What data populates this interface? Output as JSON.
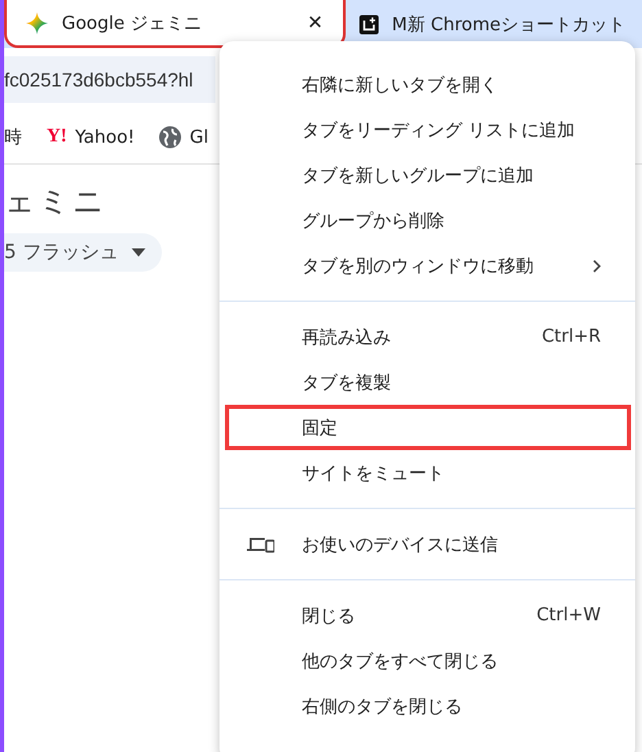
{
  "tabs": [
    {
      "title": "Google ジェミニ",
      "close": "✕",
      "selected": true,
      "highlighted": true
    },
    {
      "title": "M新 Chromeショートカット",
      "selected": false,
      "highlighted": false
    }
  ],
  "address_bar": {
    "url": "fc025173d6bcb554?hl"
  },
  "bookmarks": [
    {
      "kind": "plain",
      "label": "時"
    },
    {
      "kind": "yahoo",
      "logo": "Y!",
      "label": "Yahoo!"
    },
    {
      "kind": "globe",
      "label": "Gl"
    }
  ],
  "page": {
    "heading": "ェミニ",
    "model_chip": "5 フラッシュ"
  },
  "context_menu": {
    "sections": [
      {
        "items": [
          {
            "label": "右隣に新しいタブを開く",
            "highlighted": false
          },
          {
            "label": "タブをリーディング リストに追加",
            "highlighted": false
          },
          {
            "label": "タブを新しいグループに追加",
            "highlighted": false
          },
          {
            "label": "グループから削除",
            "highlighted": false
          },
          {
            "label": "タブを別のウィンドウに移動",
            "submenu": true,
            "highlighted": false
          }
        ]
      },
      {
        "items": [
          {
            "label": "再読み込み",
            "shortcut": "Ctrl+R",
            "highlighted": false
          },
          {
            "label": "タブを複製",
            "highlighted": false
          },
          {
            "label": "固定",
            "highlighted": true
          },
          {
            "label": "サイトをミュート",
            "highlighted": false
          }
        ]
      },
      {
        "items": [
          {
            "label": "お使いのデバイスに送信",
            "kind": "device",
            "highlighted": false
          }
        ]
      },
      {
        "items": [
          {
            "label": "閉じる",
            "shortcut": "Ctrl+W",
            "highlighted": false
          },
          {
            "label": "他のタブをすべて閉じる",
            "highlighted": false
          },
          {
            "label": "右側のタブを閉じる",
            "highlighted": false
          }
        ]
      }
    ]
  }
}
